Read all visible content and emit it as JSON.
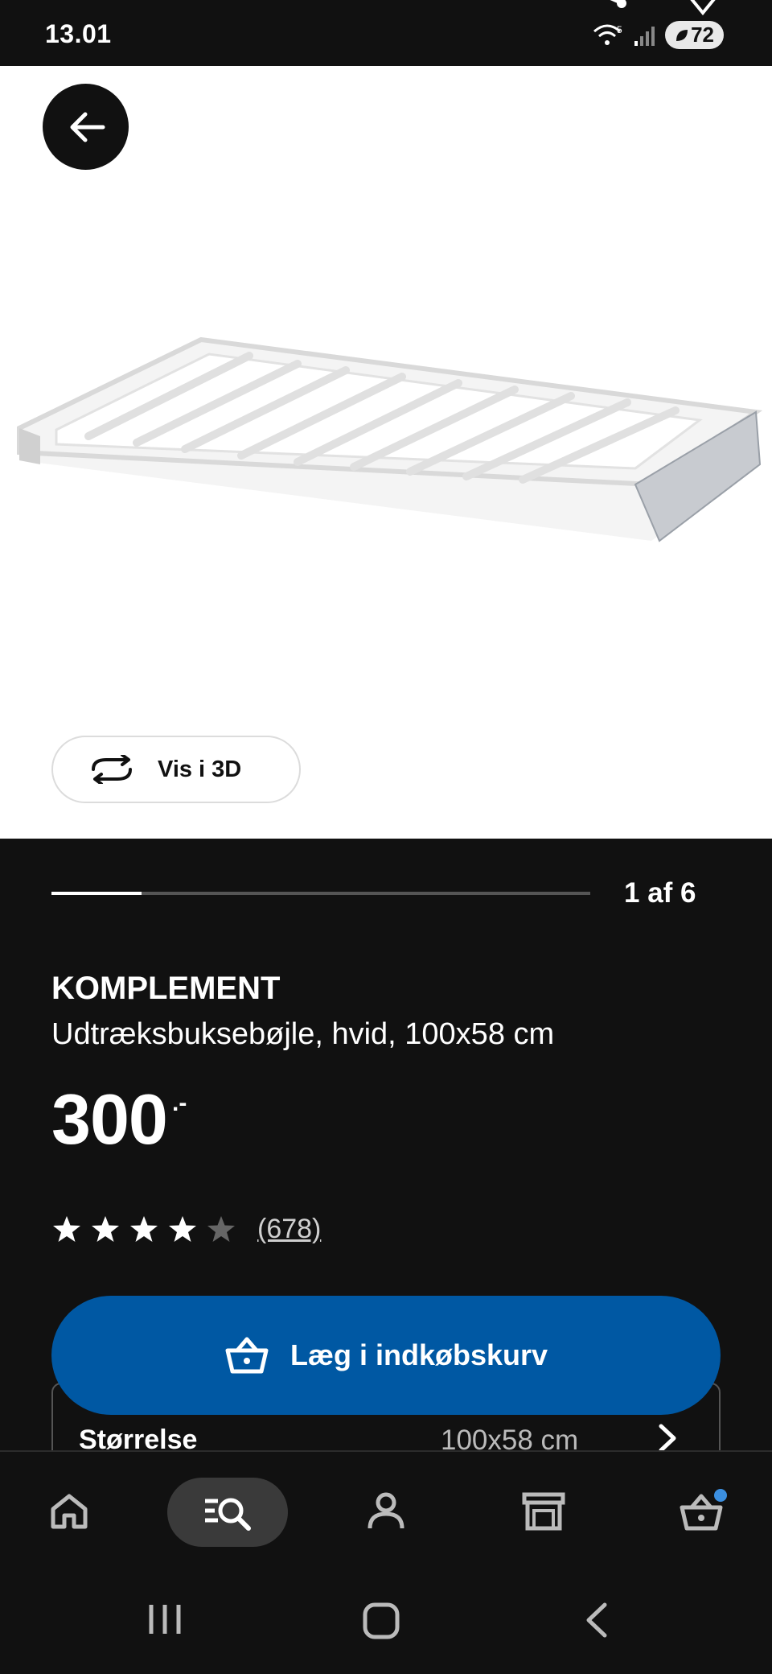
{
  "status_bar": {
    "time": "13.01",
    "battery": "72",
    "wifi_badge": "5"
  },
  "media": {
    "view_3d_label": "Vis i 3D",
    "image_counter": "1 af 6",
    "progress_fraction": 0.1667
  },
  "product": {
    "brand": "KOMPLEMENT",
    "description": "Udtræksbuksebøjle, hvid, 100x58 cm",
    "price": "300",
    "price_suffix": ".-",
    "rating": 4,
    "rating_max": 5,
    "review_count": "(678)"
  },
  "actions": {
    "add_to_cart_label": "Læg i indkøbskurv"
  },
  "size": {
    "label": "Størrelse",
    "value": "100x58 cm"
  },
  "bottom_nav": {
    "items": [
      {
        "icon": "home-icon"
      },
      {
        "icon": "search-icon"
      },
      {
        "icon": "profile-icon"
      },
      {
        "icon": "store-icon"
      },
      {
        "icon": "cart-icon"
      }
    ],
    "active": "search-icon",
    "accent_color": "#0058a3",
    "badge_color": "#3b8fe0"
  }
}
